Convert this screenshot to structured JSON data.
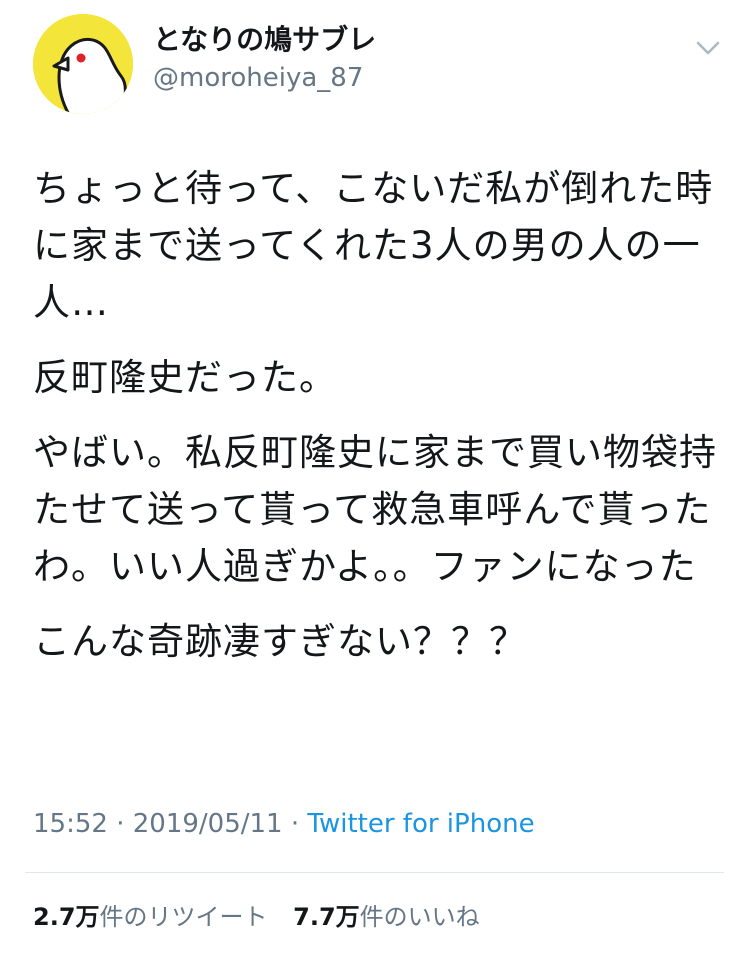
{
  "user": {
    "display_name": "となりの鳩サブレ",
    "handle": "@moroheiya_87",
    "avatar_icon": "pigeon-avatar"
  },
  "tweet": {
    "paragraphs": [
      "ちょっと待って、こないだ私が倒れた時に家まで送ってくれた3人の男の人の一人…",
      "反町隆史だった。",
      "やばい。私反町隆史に家まで買い物袋持たせて送って貰って救急車呼んで貰ったわ。いい人過ぎかよ。。ファンになった",
      "こんな奇跡凄すぎない？？？"
    ]
  },
  "meta": {
    "time": "15:52",
    "separator": "·",
    "date": "2019/05/11",
    "source": "Twitter for iPhone"
  },
  "stats": {
    "retweets_count": "2.7万",
    "retweets_label": "件のリツイート",
    "likes_count": "7.7万",
    "likes_label": "件のいいね"
  },
  "colors": {
    "text": "#14171a",
    "secondary": "#657786",
    "link": "#1b95e0",
    "avatar_bg": "#f4e53a"
  },
  "icons": {
    "menu": "chevron-down-icon"
  }
}
